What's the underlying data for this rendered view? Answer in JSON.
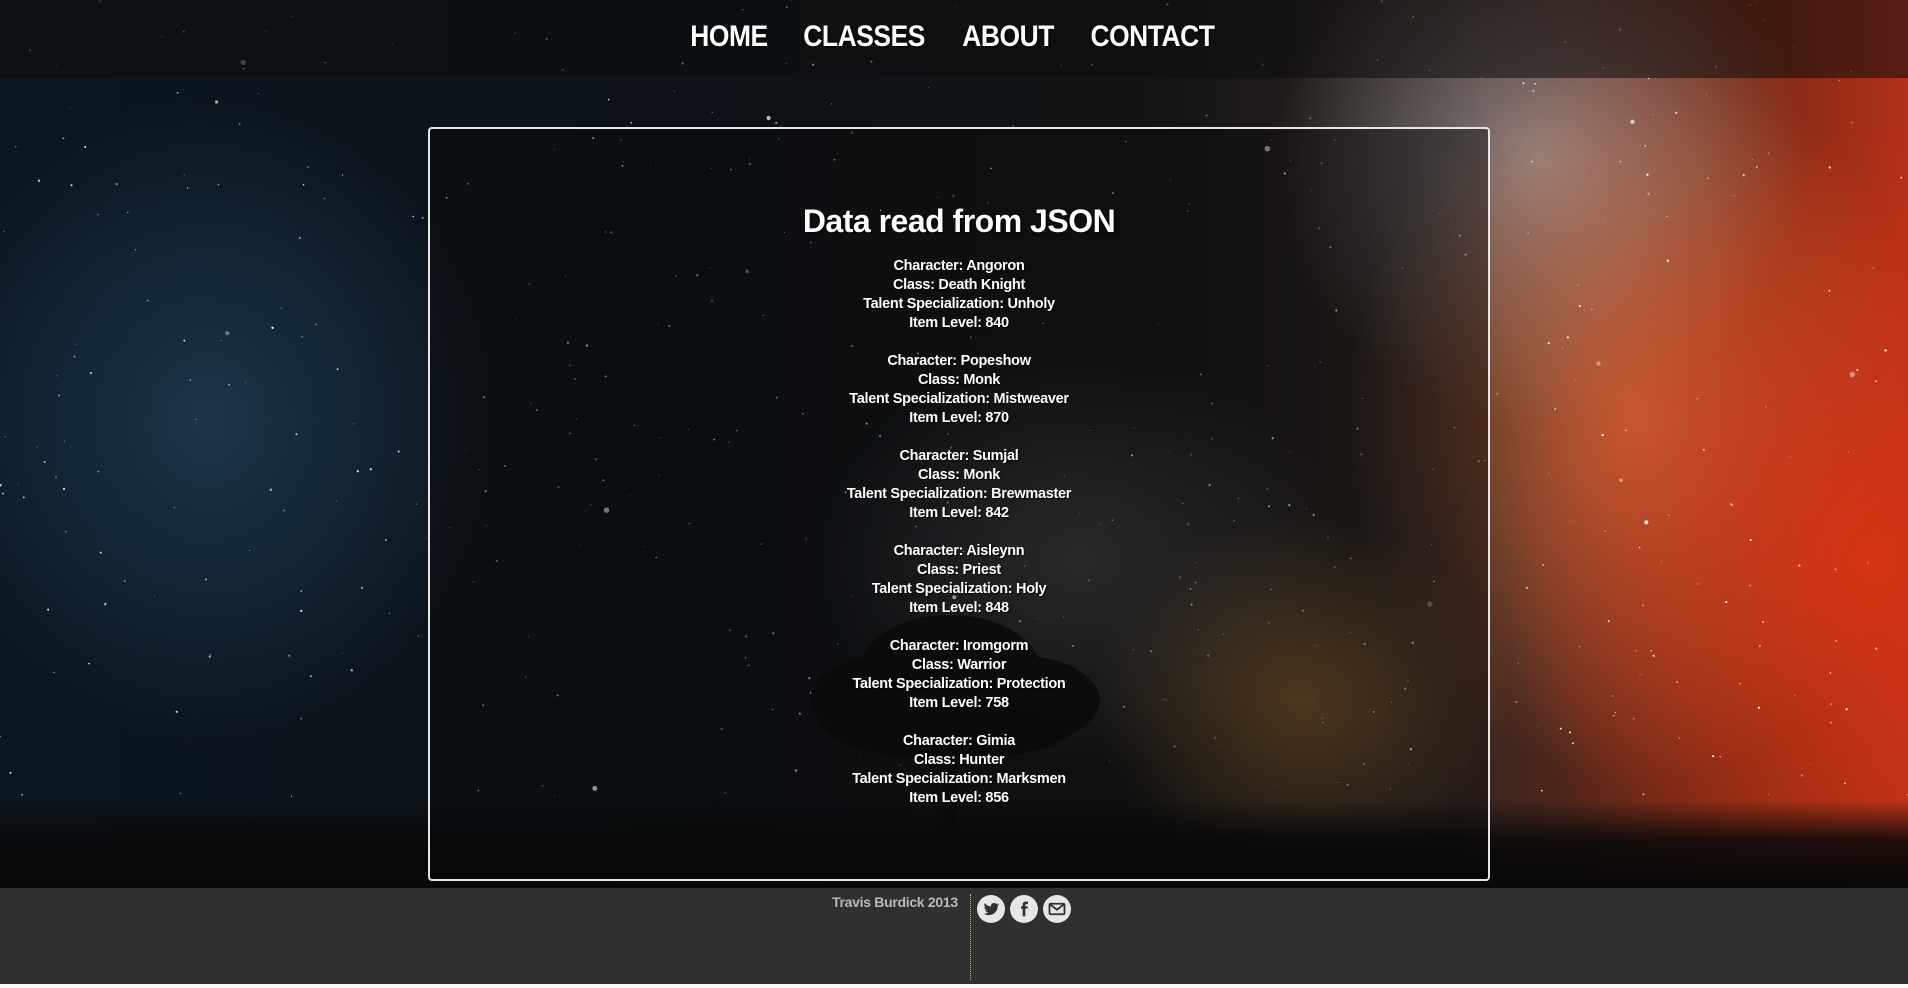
{
  "nav": {
    "items": [
      {
        "label": "HOME"
      },
      {
        "label": "CLASSES"
      },
      {
        "label": "ABOUT"
      },
      {
        "label": "CONTACT"
      }
    ]
  },
  "main": {
    "title": "Data read from JSON",
    "records": [
      {
        "character": "Character: Angoron",
        "class": "Class: Death Knight",
        "spec": "Talent Specialization: Unholy",
        "item_level": "Item Level: 840"
      },
      {
        "character": "Character: Popeshow",
        "class": "Class: Monk",
        "spec": "Talent Specialization: Mistweaver",
        "item_level": "Item Level: 870"
      },
      {
        "character": "Character: Sumjal",
        "class": "Class: Monk",
        "spec": "Talent Specialization: Brewmaster",
        "item_level": "Item Level: 842"
      },
      {
        "character": "Character: Aisleynn",
        "class": "Class: Priest",
        "spec": "Talent Specialization: Holy",
        "item_level": "Item Level: 848"
      },
      {
        "character": "Character: Iromgorm",
        "class": "Class: Warrior",
        "spec": "Talent Specialization: Protection",
        "item_level": "Item Level: 758"
      },
      {
        "character": "Character: Gimia",
        "class": "Class: Hunter",
        "spec": "Talent Specialization: Marksmen",
        "item_level": "Item Level: 856"
      }
    ]
  },
  "footer": {
    "credit": "Travis Burdick 2013",
    "social": [
      {
        "icon": "twitter-icon"
      },
      {
        "icon": "facebook-icon"
      },
      {
        "icon": "mail-icon"
      }
    ]
  },
  "colors": {
    "panel_border": "#e6e6e6",
    "footer_bg": "#303030",
    "footer_text": "#b9b9b9",
    "divider": "#c8c04a"
  }
}
